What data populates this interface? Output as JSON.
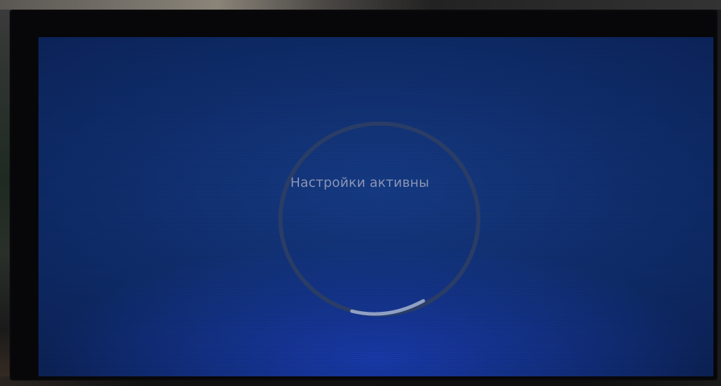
{
  "screen": {
    "status_text": "Настройки активны",
    "colors": {
      "screen_blue": "#153a84",
      "ring": "#2a3d66",
      "ring_progress": "#8fa0c4",
      "text": "#8c95b4"
    },
    "icons": [
      "loading-ring-icon"
    ]
  }
}
